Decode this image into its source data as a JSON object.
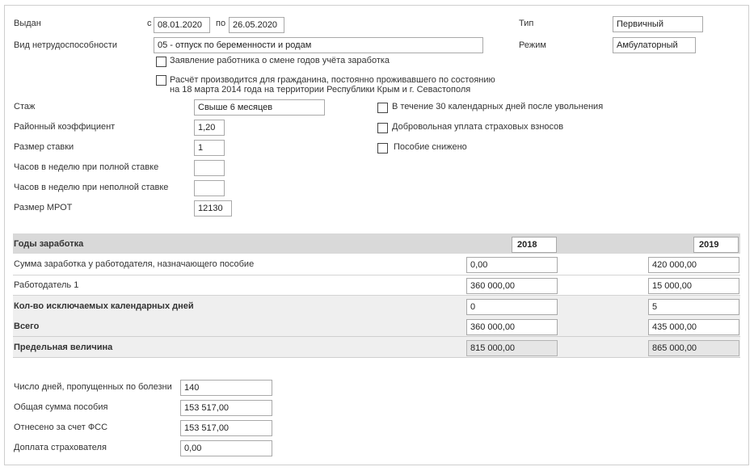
{
  "header": {
    "issued_label": "Выдан",
    "from_label": "с",
    "date_from": "08.01.2020",
    "to_label": "по",
    "date_to": "26.05.2020",
    "type_label": "Тип",
    "type_value": "Первичный",
    "mode_label": "Режим",
    "mode_value": "Амбулаторный",
    "disability_type_label": "Вид нетрудоспособности",
    "disability_type_value": "05 - отпуск по беременности и родам",
    "checkbox_change_years": "Заявление работника о смене годов учёта заработка",
    "checkbox_crimea_line1": "Расчёт производится для гражданина, постоянно проживавшего по состоянию",
    "checkbox_crimea_line2": "на 18 марта 2014 года на территории Республики Крым и г. Севастополя"
  },
  "params": {
    "experience_label": "Стаж",
    "experience_value": "Свыше 6 месяцев",
    "district_coef_label": "Районный коэффициент",
    "district_coef_value": "1,20",
    "rate_size_label": "Размер ставки",
    "rate_size_value": "1",
    "hours_full_label": "Часов в неделю при полной ставке",
    "hours_full_value": "",
    "hours_part_label": "Часов в неделю при неполной ставке",
    "hours_part_value": "",
    "mrot_label": "Размер МРОТ",
    "mrot_value": "12130",
    "check_30_days": "В течение 30 календарных дней после увольнения",
    "check_voluntary": "Добровольная уплата страховых взносов",
    "check_reduced": "Пособие снижено"
  },
  "earnings": {
    "header_label": "Годы заработка",
    "year1": "2018",
    "year2": "2019",
    "rows": [
      {
        "label": "Сумма заработка у работодателя, назначающего пособие",
        "v1": "0,00",
        "v2": "420 000,00"
      },
      {
        "label": "Работодатель 1",
        "v1": "360 000,00",
        "v2": "15 000,00"
      },
      {
        "label": "Кол-во исключаемых календарных дней",
        "v1": "0",
        "v2": "5"
      },
      {
        "label": "Всего",
        "v1": "360 000,00",
        "v2": "435 000,00"
      },
      {
        "label": "Предельная величина",
        "v1": "815 000,00",
        "v2": "865 000,00"
      }
    ]
  },
  "summary": {
    "sick_days_label": "Число дней, пропущенных по болезни",
    "sick_days_value": "140",
    "total_benefit_label": "Общая сумма пособия",
    "total_benefit_value": "153 517,00",
    "fss_label": "Отнесено за счет ФСС",
    "fss_value": "153 517,00",
    "insurer_extra_label": "Доплата страхователя",
    "insurer_extra_value": "0,00"
  },
  "colors": {
    "band_dark": "#d9d9d9",
    "band_light": "#efefef",
    "readonly_field": "#e6e6e6"
  }
}
